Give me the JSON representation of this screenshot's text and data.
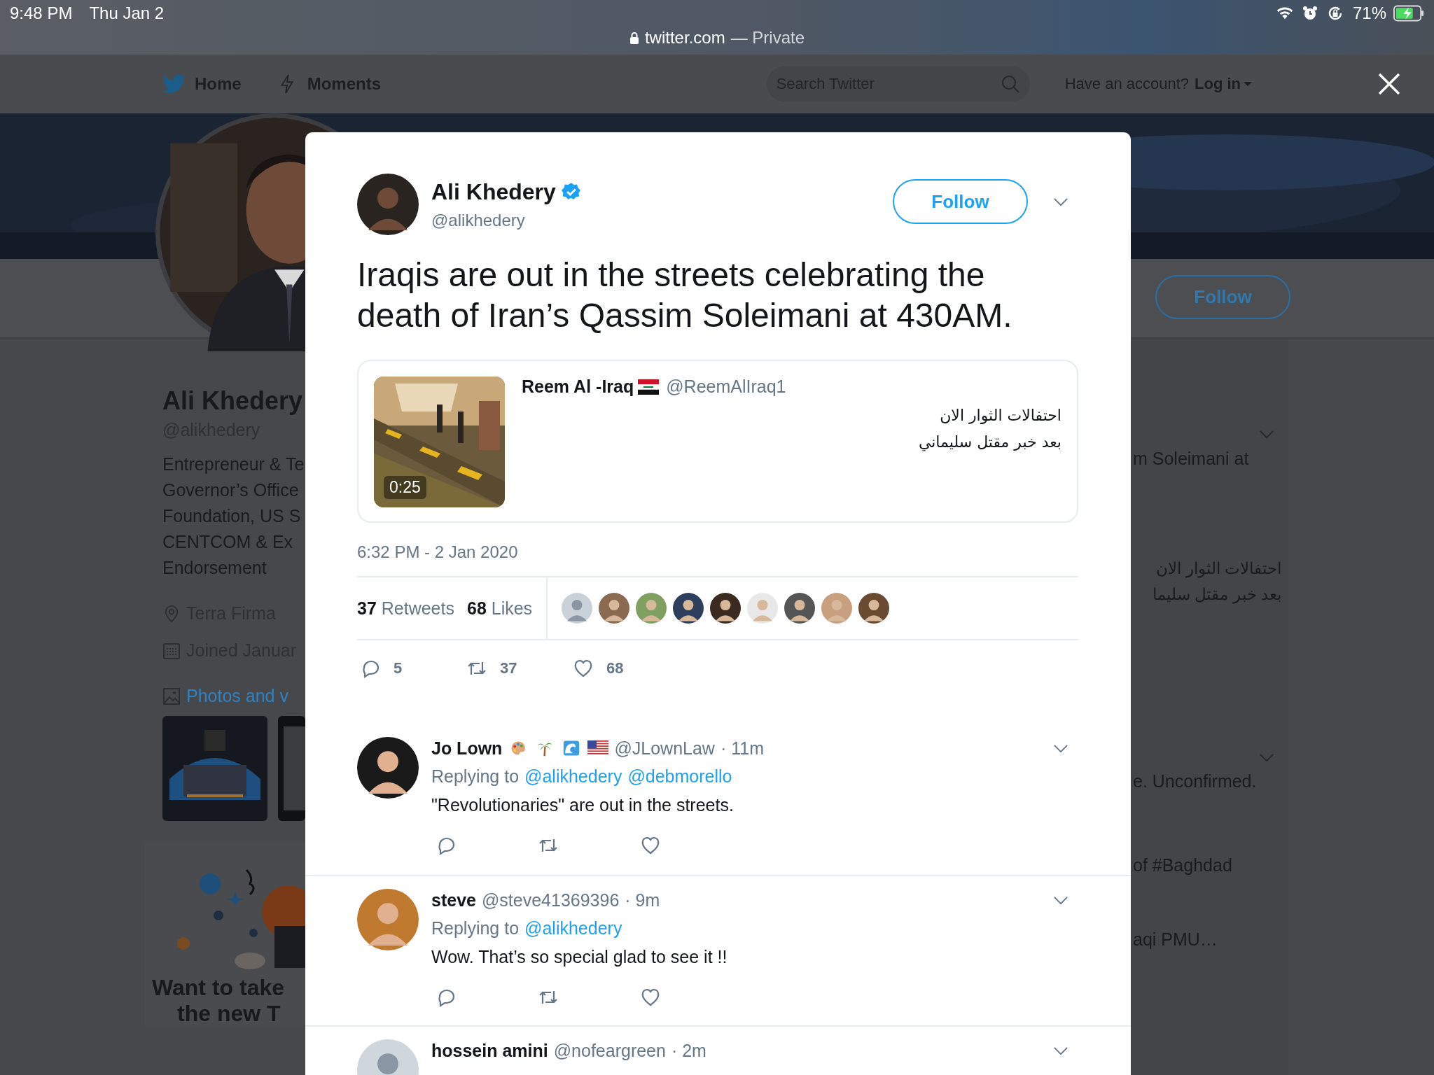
{
  "status_bar": {
    "time": "9:48 PM",
    "date": "Thu Jan 2",
    "battery": "71%"
  },
  "address_bar": {
    "domain": "twitter.com",
    "mode": "— Private"
  },
  "nav": {
    "items": [
      {
        "label": "Home",
        "kind": "home"
      },
      {
        "label": "Moments",
        "kind": "moments"
      }
    ],
    "search": {
      "placeholder": "Search Twitter"
    },
    "account_prompt": "Have an account?",
    "login": "Log in"
  },
  "profile": {
    "name": "Ali Khedery",
    "handle": "@alikhedery",
    "bio": [
      "Entrepreneur & Te",
      "Governor’s Office",
      "Foundation, US S",
      "CENTCOM & Ex",
      "Endorsement"
    ],
    "location": "Terra Firma",
    "joined": "Joined Januar",
    "media_link": "Photos and v",
    "media": [
      {
        "kind": "picture"
      },
      {
        "kind": "picture"
      }
    ],
    "promo": [
      "Want to take",
      "the new T"
    ],
    "follow": "Follow"
  },
  "timeline_fragments": [
    {
      "kind": "chevron"
    },
    {
      "kind": "text",
      "text": "m Soleimani at"
    },
    {
      "kind": "rtl_text",
      "text": "احتفالات الثوار الان"
    },
    {
      "kind": "rtl_text",
      "text": "بعد خبر مقتل سليما"
    },
    {
      "kind": "chevron"
    },
    {
      "kind": "text",
      "text": "e. Unconfirmed."
    },
    {
      "kind": "text",
      "text": "of #Baghdad"
    },
    {
      "kind": "text",
      "text": "aqi PMU…"
    }
  ],
  "tweet": {
    "author": {
      "name": "Ali Khedery",
      "handle": "@alikhedery",
      "verified": true
    },
    "follow": "Follow",
    "text": "Iraqis are out in the streets celebrating the death of Iran’s Qassim Soleimani at 430AM.",
    "quote": {
      "author": "Reem Al -Iraq",
      "name_icons": [
        {
          "kind": "iraq-flag"
        }
      ],
      "handle": "@ReemAlIraq1",
      "lines": [
        "احتفالات الثوار الان",
        "بعد خبر مقتل سليماني"
      ],
      "video_duration": "0:25"
    },
    "timestamp": "6:32 PM - 2 Jan 2020",
    "retweets": {
      "count": "37",
      "label": "Retweets"
    },
    "likes": {
      "count": "68",
      "label": "Likes"
    },
    "liked_by": [
      {
        "kind": "picture"
      },
      {
        "kind": "picture"
      },
      {
        "kind": "picture"
      },
      {
        "kind": "picture"
      },
      {
        "kind": "picture"
      },
      {
        "kind": "picture"
      },
      {
        "kind": "picture"
      },
      {
        "kind": "picture"
      },
      {
        "kind": "picture"
      }
    ],
    "actions": [
      {
        "kind": "reply",
        "count": "5"
      },
      {
        "kind": "retweet",
        "count": "37"
      },
      {
        "kind": "like",
        "count": "68"
      }
    ]
  },
  "replies": [
    {
      "name": "Jo Lown",
      "name_icons": [
        {
          "kind": "palette"
        },
        {
          "kind": "palm"
        },
        {
          "kind": "wave"
        },
        {
          "kind": "us-flag"
        }
      ],
      "handle": "@JLownLaw",
      "time": "· 11m",
      "replying_label": "Replying to",
      "mentions": [
        "@alikhedery",
        "@debmorello"
      ],
      "text": "\"Revolutionaries\" are out in the streets.",
      "actions": [
        {
          "kind": "reply"
        },
        {
          "kind": "retweet"
        },
        {
          "kind": "like"
        }
      ]
    },
    {
      "name": "steve",
      "handle": "@steve41369396",
      "time": "· 9m",
      "replying_label": "Replying to",
      "mentions": [
        "@alikhedery"
      ],
      "text": "Wow. That’s so special glad to see it !!",
      "actions": [
        {
          "kind": "reply"
        },
        {
          "kind": "retweet"
        },
        {
          "kind": "like"
        }
      ]
    },
    {
      "name": "hossein amini",
      "handle": "@nofeargreen",
      "time": "· 2m"
    }
  ]
}
